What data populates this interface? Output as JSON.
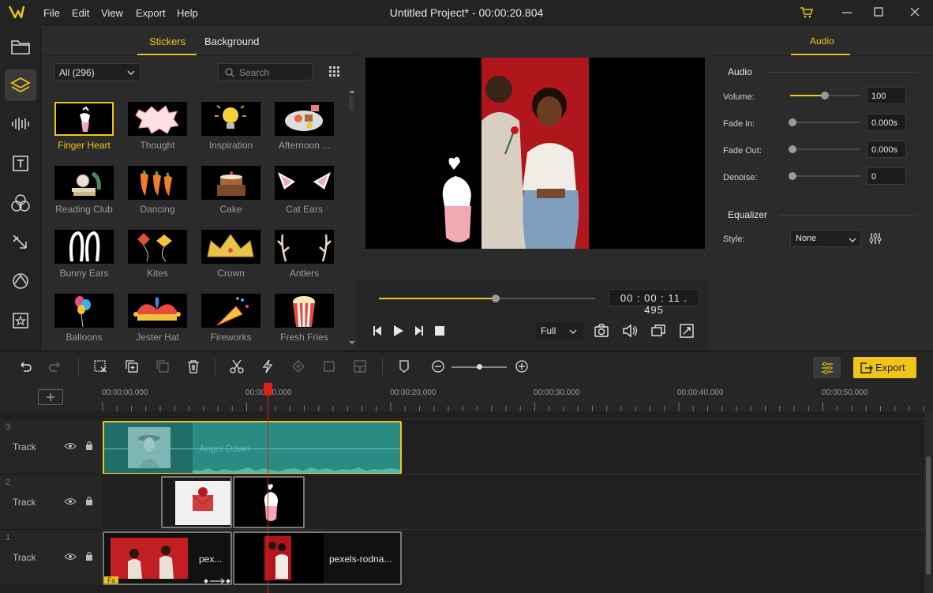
{
  "app": {
    "title": "Untitled Project* - 00:00:20.804",
    "menu": [
      "File",
      "Edit",
      "View",
      "Export",
      "Help"
    ]
  },
  "library": {
    "tabs": [
      "Stickers",
      "Background"
    ],
    "active_tab": "Stickers",
    "filter": "All (296)",
    "search_placeholder": "Search",
    "stickers": [
      {
        "label": "Finger Heart",
        "icon": "finger-heart",
        "selected": true
      },
      {
        "label": "Thought",
        "icon": "thought-bubble"
      },
      {
        "label": "Inspiration",
        "icon": "light-bulb"
      },
      {
        "label": "Afternoon ...",
        "icon": "afternoon-tea"
      },
      {
        "label": "Reading Club",
        "icon": "books-clock"
      },
      {
        "label": "Dancing",
        "icon": "dancing-carrots"
      },
      {
        "label": "Cake",
        "icon": "cake"
      },
      {
        "label": "Cat Ears",
        "icon": "cat-ears"
      },
      {
        "label": "Bunny Ears",
        "icon": "bunny-ears"
      },
      {
        "label": "Kites",
        "icon": "kites"
      },
      {
        "label": "Crown",
        "icon": "crown"
      },
      {
        "label": "Antlers",
        "icon": "antlers"
      },
      {
        "label": "Balloons",
        "icon": "balloons"
      },
      {
        "label": "Jester Hat",
        "icon": "jester-hat"
      },
      {
        "label": "Fireworks",
        "icon": "party-popper"
      },
      {
        "label": "Fresh Fries",
        "icon": "popcorn"
      }
    ]
  },
  "preview": {
    "timecode": "00 : 00 : 11 . 495",
    "progress": 0.54,
    "zoom": "Full"
  },
  "properties": {
    "tab": "Audio",
    "audio_section": "Audio",
    "volume_label": "Volume:",
    "volume": "100",
    "volume_level": 0.5,
    "fade_in_label": "Fade In:",
    "fade_in": "0.000s",
    "fade_out_label": "Fade Out:",
    "fade_out": "0.000s",
    "denoise_label": "Denoise:",
    "denoise": "0",
    "equalizer_section": "Equalizer",
    "style_label": "Style:",
    "style": "None"
  },
  "toolbar": {
    "export_label": "Export"
  },
  "timeline": {
    "ruler": [
      "00:00:00.000",
      "00:00:10.000",
      "00:00:20.000",
      "00:00:30.000",
      "00:00:40.000",
      "00:00:50.000"
    ],
    "playhead_time": "00:00:11.495",
    "tracks": [
      {
        "number": "3",
        "name": "Track"
      },
      {
        "number": "2",
        "name": "Track"
      },
      {
        "number": "1",
        "name": "Track"
      }
    ],
    "clips": {
      "audio_title": "Angel Down",
      "video1_label": "pex...",
      "video2_label": "pexels-rodna...",
      "fx_badge": "Fx"
    }
  },
  "colors": {
    "accent": "#f0c419",
    "audio_clip": "#2a8a84",
    "playhead": "#e0201c"
  }
}
